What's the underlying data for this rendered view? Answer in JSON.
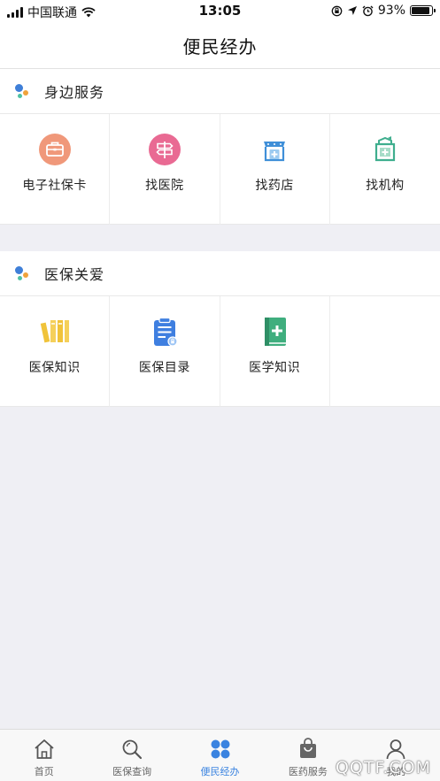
{
  "status_bar": {
    "carrier": "中国联通",
    "time": "13:05",
    "battery": "93%",
    "battery_level": 0.93
  },
  "header": {
    "title": "便民经办"
  },
  "sections": [
    {
      "title": "身边服务",
      "items": [
        {
          "label": "电子社保卡",
          "icon": "briefcase-icon",
          "color": "#f0987a"
        },
        {
          "label": "找医院",
          "icon": "signpost-icon",
          "color": "#e96a93"
        },
        {
          "label": "找药店",
          "icon": "pharmacy-icon",
          "color": "#3f8fd8"
        },
        {
          "label": "找机构",
          "icon": "institution-icon",
          "color": "#3fae8e"
        }
      ]
    },
    {
      "title": "医保关爱",
      "items": [
        {
          "label": "医保知识",
          "icon": "books-icon",
          "color": "#f0c33a"
        },
        {
          "label": "医保目录",
          "icon": "clipboard-icon",
          "color": "#3f7fe0"
        },
        {
          "label": "医学知识",
          "icon": "medical-book-icon",
          "color": "#3fae7e"
        }
      ]
    }
  ],
  "tabbar": [
    {
      "label": "首页",
      "icon": "home-icon"
    },
    {
      "label": "医保查询",
      "icon": "search-icon"
    },
    {
      "label": "便民经办",
      "icon": "grid-icon",
      "active": true
    },
    {
      "label": "医药服务",
      "icon": "bag-icon"
    },
    {
      "label": "我的",
      "icon": "user-icon"
    }
  ],
  "colors": {
    "accent": "#3a83e0",
    "background": "#efeff4"
  },
  "watermark": "QQTF.COM"
}
